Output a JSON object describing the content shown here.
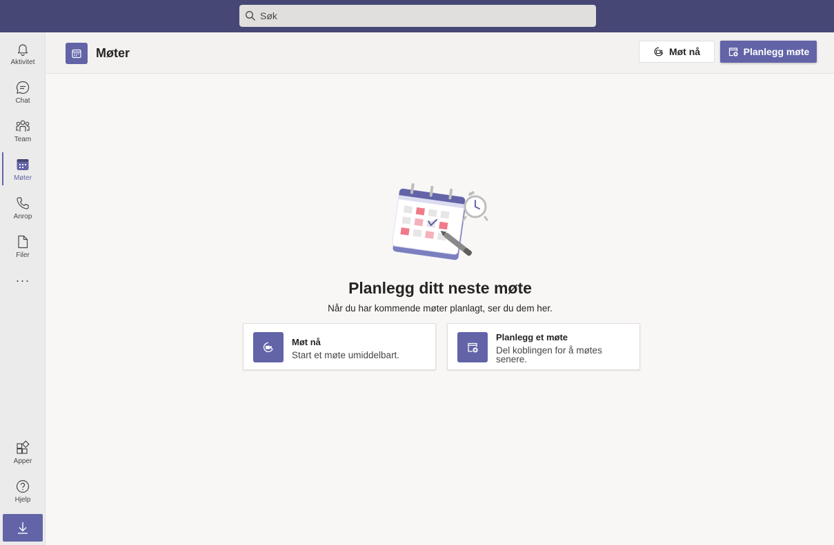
{
  "search": {
    "placeholder": "Søk"
  },
  "rail": {
    "items": [
      {
        "label": "Aktivitet",
        "icon": "bell-icon"
      },
      {
        "label": "Chat",
        "icon": "chat-icon"
      },
      {
        "label": "Team",
        "icon": "team-icon"
      },
      {
        "label": "Møter",
        "icon": "calendar-icon",
        "active": true
      },
      {
        "label": "Anrop",
        "icon": "phone-icon"
      },
      {
        "label": "Filer",
        "icon": "file-icon"
      }
    ],
    "more": "···",
    "bottom": [
      {
        "label": "Apper",
        "icon": "apps-icon"
      },
      {
        "label": "Hjelp",
        "icon": "help-icon"
      }
    ],
    "download_icon": "download-icon"
  },
  "header": {
    "title": "Møter",
    "meet_now_label": "Møt nå",
    "schedule_label": "Planlegg møte"
  },
  "empty_state": {
    "title": "Planlegg ditt neste møte",
    "subtitle": "Når du har kommende møter planlagt, ser du dem her.",
    "cards": [
      {
        "title": "Møt nå",
        "description": "Start et møte umiddelbart."
      },
      {
        "title": "Planlegg et møte",
        "description": "Del koblingen for å møtes senere."
      }
    ]
  },
  "colors": {
    "accent": "#6264a7",
    "topbar": "#464775"
  }
}
